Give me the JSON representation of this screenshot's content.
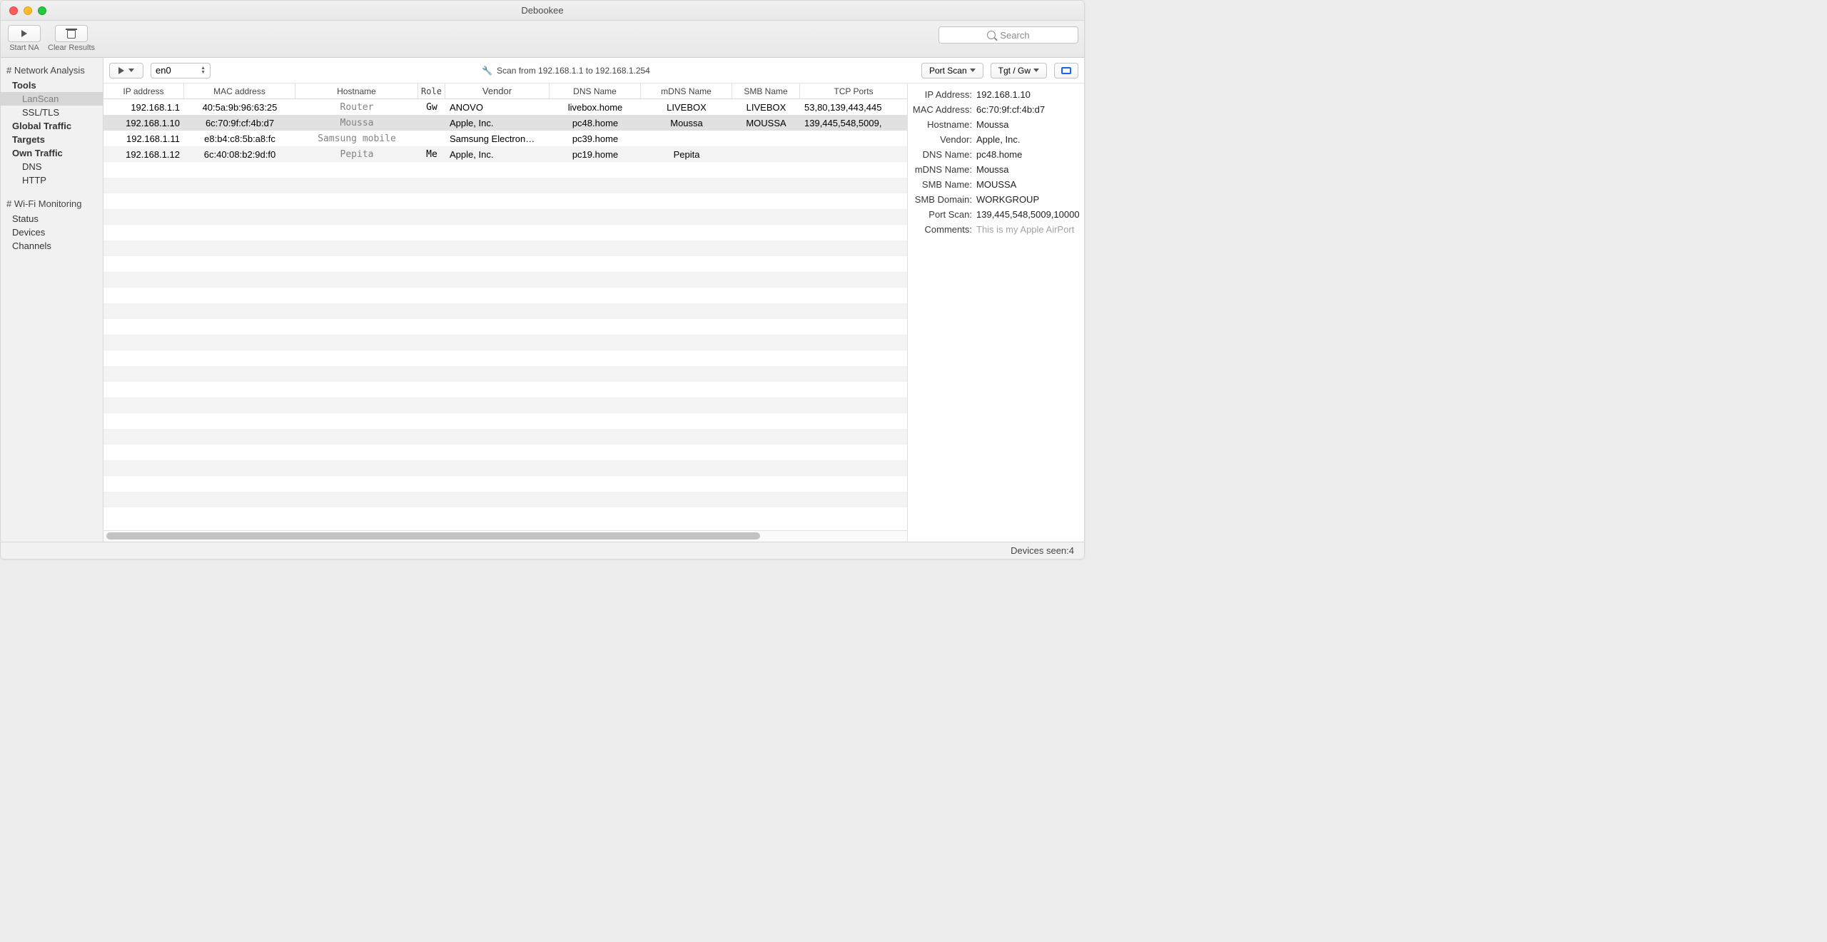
{
  "app_title": "Debookee",
  "toolbar": {
    "start_label": "Start NA",
    "clear_label": "Clear Results",
    "search_placeholder": "Search"
  },
  "sidebar": {
    "section_na": "# Network Analysis",
    "tools": "Tools",
    "items_tools": [
      "LanScan",
      "SSL/TLS"
    ],
    "global_traffic": "Global Traffic",
    "targets": "Targets",
    "own_traffic": "Own Traffic",
    "items_own": [
      "DNS",
      "HTTP"
    ],
    "section_wifi": "# Wi-Fi Monitoring",
    "items_wifi": [
      "Status",
      "Devices",
      "Channels"
    ]
  },
  "toprow": {
    "interface": "en0",
    "scan_text": "Scan from 192.168.1.1 to 192.168.1.254",
    "port_scan": "Port Scan",
    "tgt_gw": "Tgt / Gw"
  },
  "columns": [
    "IP address",
    "MAC address",
    "Hostname",
    "Role",
    "Vendor",
    "DNS Name",
    "mDNS Name",
    "SMB Name",
    "TCP Ports"
  ],
  "hosts": [
    {
      "ip": "192.168.1.1",
      "mac": "40:5a:9b:96:63:25",
      "host": "Router",
      "role": "Gw",
      "vendor": "ANOVO",
      "dns": "livebox.home",
      "mdns": "LIVEBOX",
      "smb": "LIVEBOX",
      "ports": "53,80,139,443,445"
    },
    {
      "ip": "192.168.1.10",
      "mac": "6c:70:9f:cf:4b:d7",
      "host": "Moussa",
      "role": "",
      "vendor": "Apple, Inc.",
      "dns": "pc48.home",
      "mdns": "Moussa",
      "smb": "MOUSSA",
      "ports": "139,445,548,5009,"
    },
    {
      "ip": "192.168.1.11",
      "mac": "e8:b4:c8:5b:a8:fc",
      "host": "Samsung mobile",
      "role": "",
      "vendor": "Samsung Electron…",
      "dns": "pc39.home",
      "mdns": "",
      "smb": "",
      "ports": ""
    },
    {
      "ip": "192.168.1.12",
      "mac": "6c:40:08:b2:9d:f0",
      "host": "Pepita",
      "role": "Me",
      "vendor": "Apple, Inc.",
      "dns": "pc19.home",
      "mdns": "Pepita",
      "smb": "",
      "ports": ""
    }
  ],
  "selected_index": 1,
  "details": {
    "rows": [
      {
        "k": "IP Address:",
        "v": "192.168.1.10"
      },
      {
        "k": "MAC Address:",
        "v": "6c:70:9f:cf:4b:d7"
      },
      {
        "k": "Hostname:",
        "v": "Moussa"
      },
      {
        "k": "Vendor:",
        "v": "Apple, Inc."
      },
      {
        "k": "DNS Name:",
        "v": "pc48.home"
      },
      {
        "k": "mDNS Name:",
        "v": "Moussa"
      },
      {
        "k": "SMB Name:",
        "v": "MOUSSA"
      },
      {
        "k": "SMB Domain:",
        "v": "WORKGROUP"
      },
      {
        "k": "Port Scan:",
        "v": "139,445,548,5009,10000"
      },
      {
        "k": "Comments:",
        "v": "This is my Apple AirPort",
        "gray": true
      }
    ]
  },
  "status": {
    "prefix": "Devices seen: ",
    "count": "4"
  }
}
